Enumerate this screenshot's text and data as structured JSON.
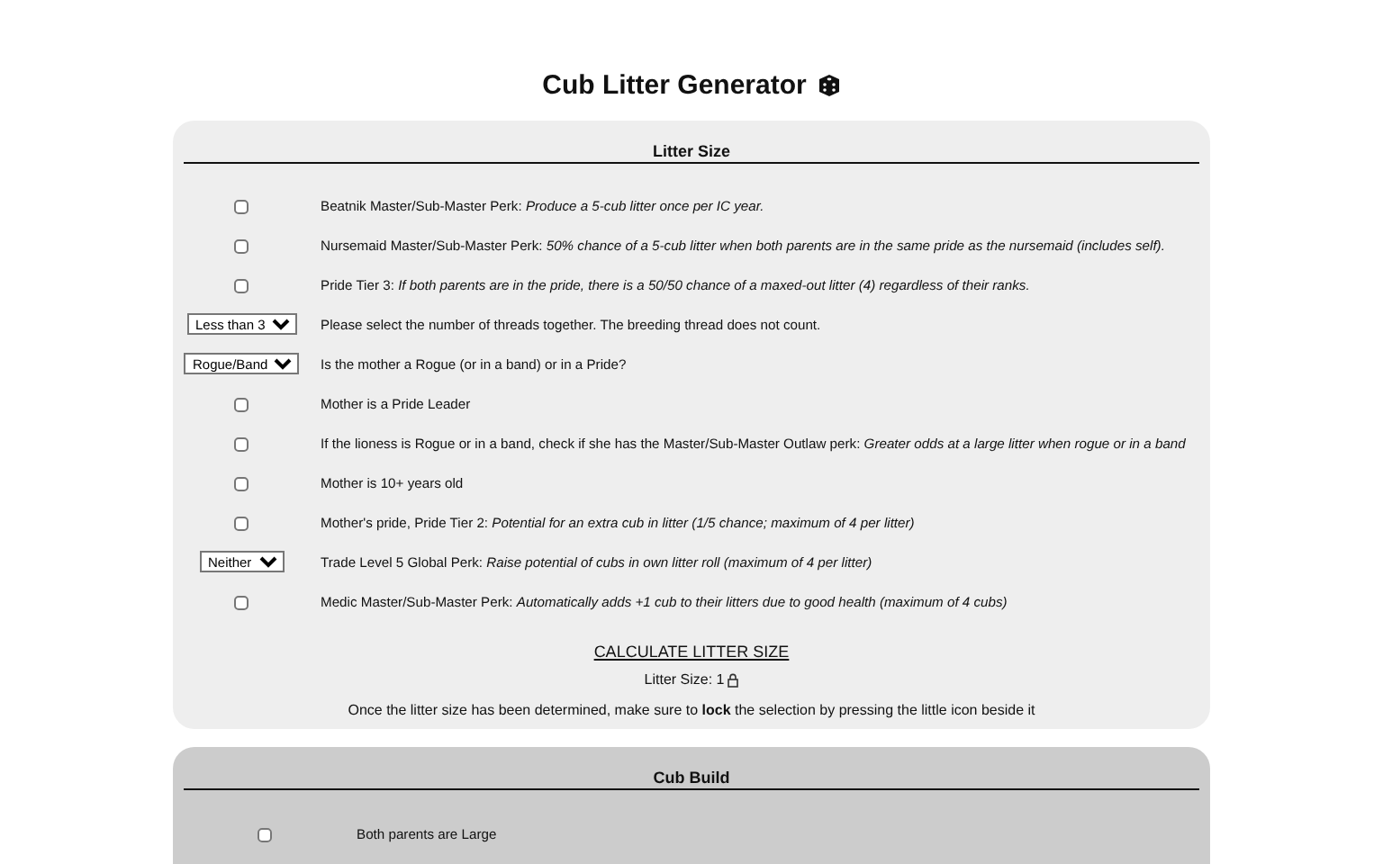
{
  "title": "Cub Litter Generator",
  "litter_size": {
    "heading": "Litter Size",
    "rows": [
      {
        "kind": "checkbox",
        "checked": false,
        "label": "Beatnik Master/Sub-Master Perk: *Produce a 5-cub litter once per IC year.*"
      },
      {
        "kind": "checkbox",
        "checked": false,
        "label": "Nursemaid Master/Sub-Master Perk: *50% chance of a 5-cub litter when both parents are in the same pride as the nursemaid (includes self).*"
      },
      {
        "kind": "checkbox",
        "checked": false,
        "label": "Pride Tier 3: *If both parents are in the pride, there is a 50/50 chance of a maxed-out litter (4) regardless of their ranks.*"
      },
      {
        "kind": "select",
        "value": "Less than 3",
        "label": "Please select the number of threads together. The breeding thread does not count."
      },
      {
        "kind": "select",
        "value": "Rogue/Band",
        "label": "Is the mother a Rogue (or in a band) or in a Pride?"
      },
      {
        "kind": "checkbox",
        "checked": false,
        "label": "Mother is a Pride Leader"
      },
      {
        "kind": "checkbox",
        "checked": false,
        "label": "If the lioness is Rogue or in a band, check if she has the Master/Sub-Master Outlaw perk: *Greater odds at a large litter when rogue or in a band*"
      },
      {
        "kind": "checkbox",
        "checked": false,
        "label": "Mother is 10+ years old"
      },
      {
        "kind": "checkbox",
        "checked": false,
        "label": "Mother's pride, Pride Tier 2: *Potential for an extra cub in litter (1/5 chance; maximum of 4 per litter)*"
      },
      {
        "kind": "select",
        "value": "Neither",
        "label": "Trade Level 5 Global Perk: *Raise potential of cubs in own litter roll (maximum of 4 per litter)*"
      },
      {
        "kind": "checkbox",
        "checked": false,
        "label": "Medic Master/Sub-Master Perk: *Automatically adds +1 cub to their litters due to good health (maximum of 4 cubs)*"
      }
    ],
    "calculate_link": "CALCULATE LITTER SIZE",
    "result": "Litter Size: 1",
    "note": "Once the litter size has been determined, make sure to **lock** the selection by pressing the little icon beside it"
  },
  "cub_build": {
    "heading": "Cub Build",
    "rows": [
      {
        "kind": "checkbox",
        "checked": false,
        "label": "Both parents are Large"
      }
    ]
  }
}
